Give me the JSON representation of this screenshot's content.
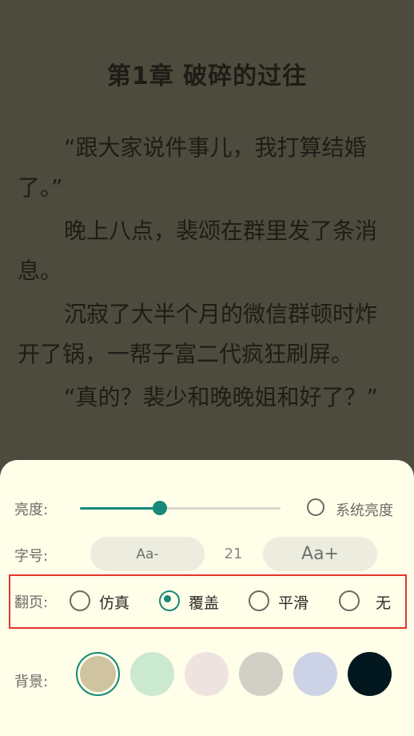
{
  "chapter": {
    "title": "第1章 破碎的过往",
    "paragraphs": [
      "“跟大家说件事儿，我打算结婚了。”",
      "晚上八点，裴颂在群里发了条消息。",
      "沉寂了大半个月的微信群顿时炸开了锅，一帮子富二代疯狂刷屏。",
      "“真的？裴少和晚晚姐和好了？”"
    ]
  },
  "settings": {
    "brightness": {
      "label": "亮度:",
      "level": 0.4,
      "system_label": "系统亮度",
      "system_checked": false
    },
    "font_size": {
      "label": "字号:",
      "decrease_label": "Aa-",
      "increase_label": "Aa+",
      "value": "21"
    },
    "page_turn": {
      "label": "翻页:",
      "options": [
        {
          "label": "仿真",
          "checked": false
        },
        {
          "label": "覆盖",
          "checked": true
        },
        {
          "label": "平滑",
          "checked": false
        },
        {
          "label": "无",
          "checked": false
        }
      ]
    },
    "background": {
      "label": "背景:",
      "colors": [
        "#d0c39f",
        "#cbe9cf",
        "#eee3df",
        "#d2d0c6",
        "#cdd3e6",
        "#03181e"
      ],
      "selected_index": 0
    }
  },
  "colors": {
    "accent": "#16897a",
    "highlight": "#e2352c"
  }
}
